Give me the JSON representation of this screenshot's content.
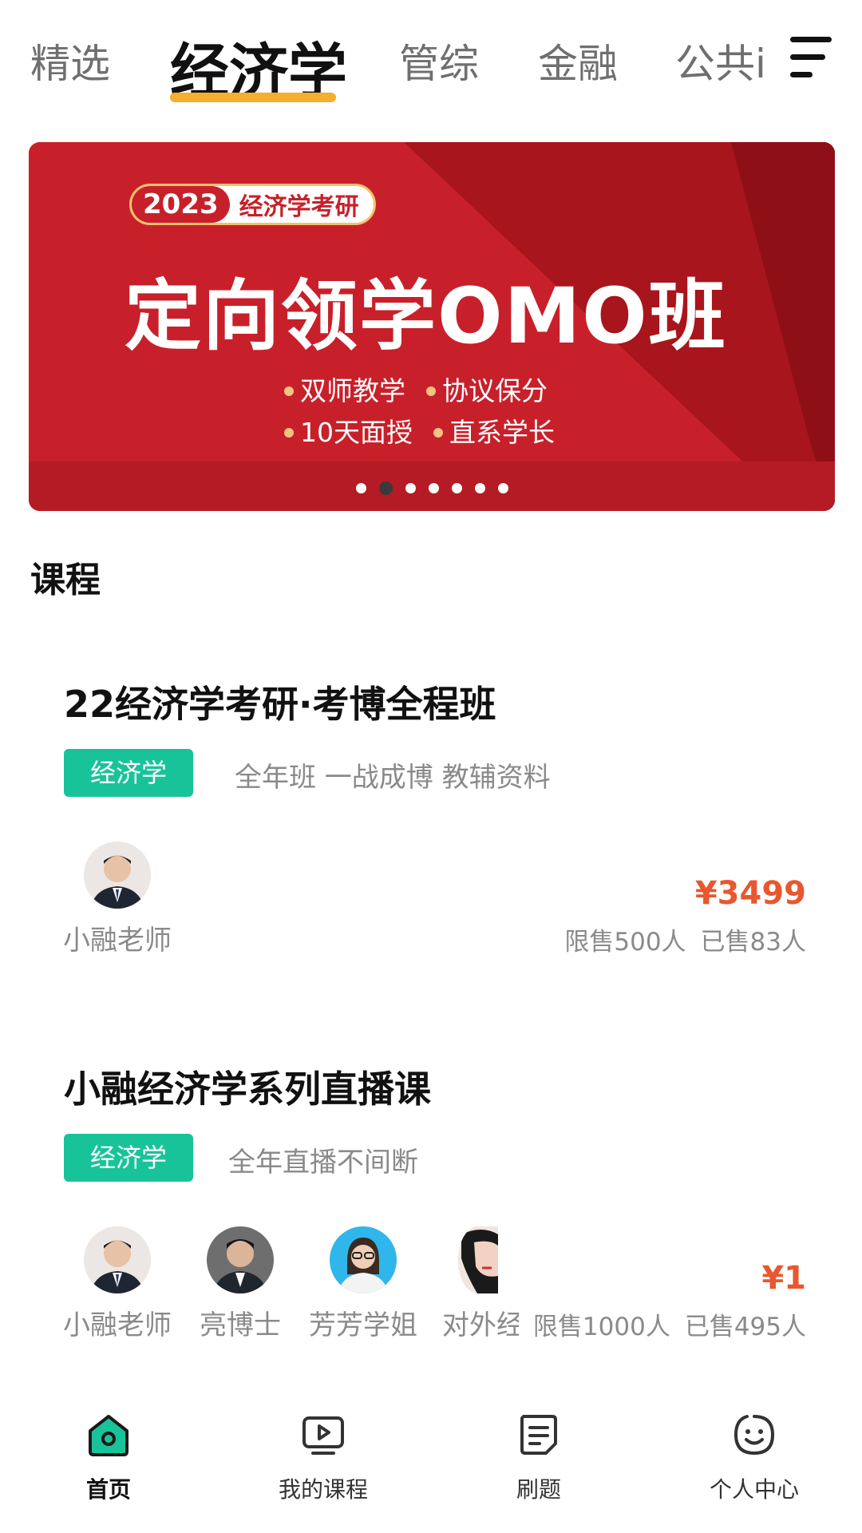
{
  "tabs": {
    "items": [
      "精选",
      "经济学",
      "管综",
      "金融",
      "公共i"
    ],
    "active": "经济学"
  },
  "banner": {
    "year": "2023",
    "tag": "经济学考研",
    "title": "定向领学OMO班",
    "bullets": [
      "双师教学",
      "协议保分",
      "10天面授",
      "直系学长"
    ],
    "colors": {
      "primary": "#c8202a",
      "accent": "#f2c480"
    }
  },
  "section": {
    "title": "课程"
  },
  "courses": [
    {
      "title": "22经济学考研·考博全程班",
      "tag": "经济学",
      "desc": "全年班 一战成博 教辅资料",
      "teachers": [
        "小融老师"
      ],
      "price": "¥3499",
      "limit": "限售500人",
      "sold": "已售83人"
    },
    {
      "title": "小融经济学系列直播课",
      "tag": "经济学",
      "desc": "全年直播不间断",
      "teachers": [
        "小融老师",
        "亮博士",
        "芳芳学姐",
        "对外经"
      ],
      "price": "¥1",
      "limit": "限售1000人",
      "sold": "已售495人"
    }
  ],
  "nav": {
    "items": [
      {
        "label": "首页",
        "icon": "home-icon"
      },
      {
        "label": "我的课程",
        "icon": "play-screen-icon"
      },
      {
        "label": "刷题",
        "icon": "document-icon"
      },
      {
        "label": "个人中心",
        "icon": "smiley-icon"
      }
    ],
    "accent": "#19c39a"
  }
}
